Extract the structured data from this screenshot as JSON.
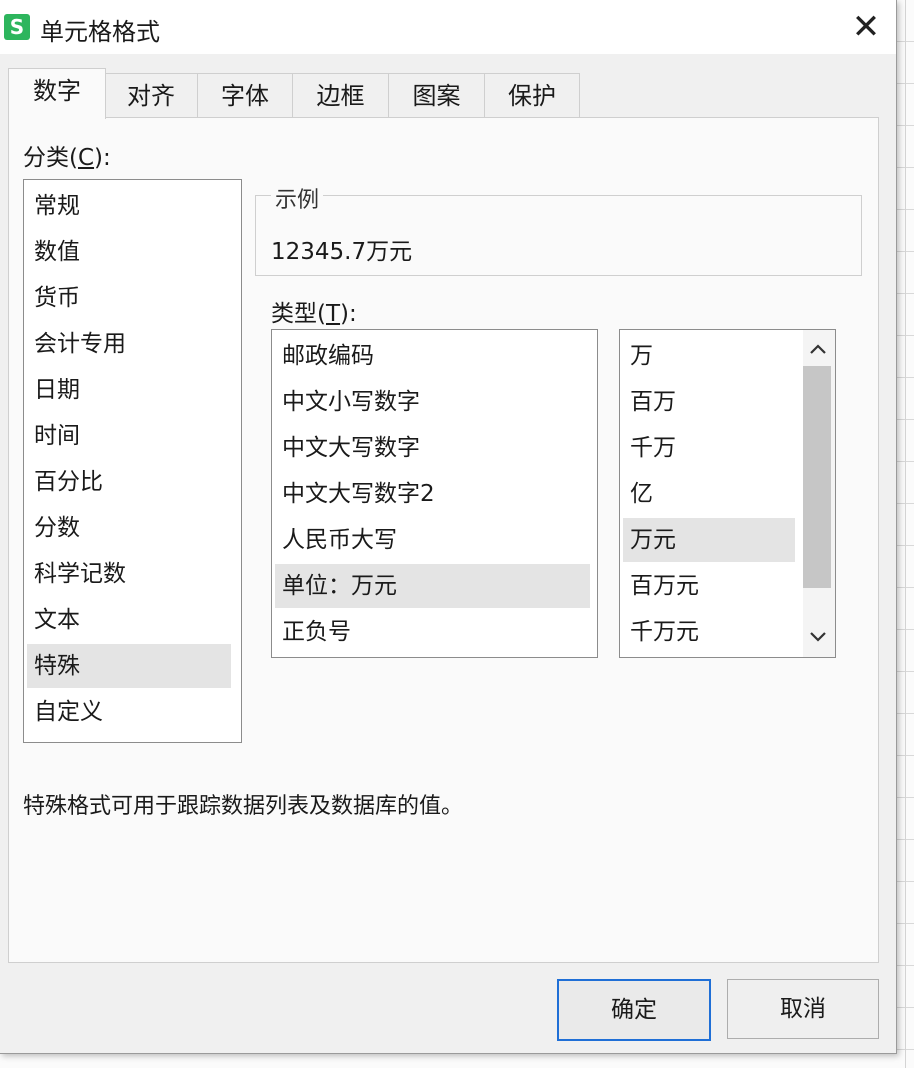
{
  "window": {
    "app_icon_letter": "S",
    "title": "单元格格式",
    "close_glyph": "✕"
  },
  "tabs": [
    {
      "label": "数字",
      "active": true
    },
    {
      "label": "对齐"
    },
    {
      "label": "字体"
    },
    {
      "label": "边框"
    },
    {
      "label": "图案"
    },
    {
      "label": "保护"
    }
  ],
  "category": {
    "label_prefix": "分类(",
    "label_key": "C",
    "label_suffix": "):",
    "items": [
      "常规",
      "数值",
      "货币",
      "会计专用",
      "日期",
      "时间",
      "百分比",
      "分数",
      "科学记数",
      "文本",
      "特殊",
      "自定义"
    ],
    "selected": "特殊"
  },
  "sample": {
    "title": "示例",
    "value": "12345.7万元"
  },
  "type": {
    "label_prefix": "类型(",
    "label_key": "T",
    "label_suffix": "):",
    "items": [
      "邮政编码",
      "中文小写数字",
      "中文大写数字",
      "中文大写数字2",
      "人民币大写",
      "单位：万元",
      "正负号"
    ],
    "selected": "单位：万元"
  },
  "unit": {
    "items": [
      "万",
      "百万",
      "千万",
      "亿",
      "万元",
      "百万元",
      "千万元"
    ],
    "selected": "万元",
    "scroll_up_icon": "chevron-up-icon",
    "scroll_down_icon": "chevron-down-icon"
  },
  "description": "特殊格式可用于跟踪数据列表及数据库的值。",
  "buttons": {
    "ok": "确定",
    "cancel": "取消"
  },
  "colors": {
    "app_icon": "#2db55d",
    "default_button_border": "#1f6fd6",
    "selection": "#e4e4e4"
  }
}
